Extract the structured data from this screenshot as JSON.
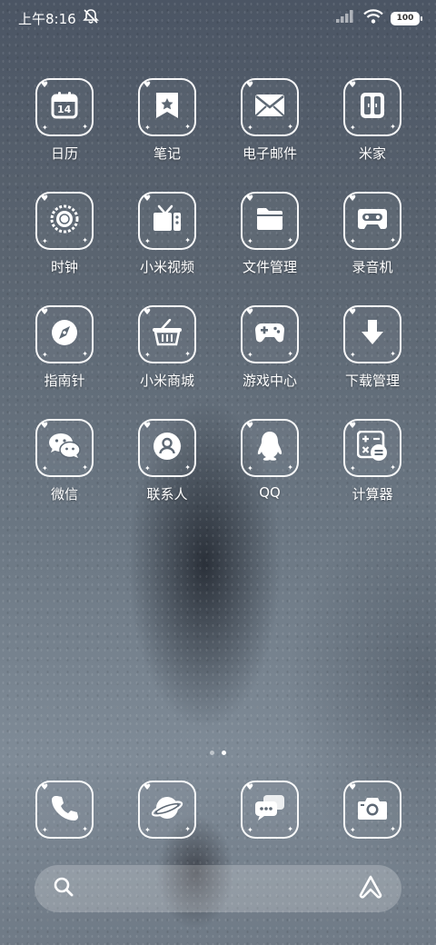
{
  "status_bar": {
    "time": "上午8:16",
    "icons": [
      "mute-icon",
      "signal-icon",
      "wifi-icon",
      "battery-icon"
    ],
    "battery": "100"
  },
  "apps": [
    {
      "label": "日历",
      "icon": "calendar-icon",
      "badge": "14"
    },
    {
      "label": "笔记",
      "icon": "notes-icon"
    },
    {
      "label": "电子邮件",
      "icon": "mail-icon"
    },
    {
      "label": "米家",
      "icon": "home-door-icon"
    },
    {
      "label": "时钟",
      "icon": "clock-icon"
    },
    {
      "label": "小米视频",
      "icon": "tv-icon"
    },
    {
      "label": "文件管理",
      "icon": "folder-icon"
    },
    {
      "label": "录音机",
      "icon": "cassette-icon"
    },
    {
      "label": "指南针",
      "icon": "compass-icon"
    },
    {
      "label": "小米商城",
      "icon": "shopping-basket-icon"
    },
    {
      "label": "游戏中心",
      "icon": "gamepad-icon"
    },
    {
      "label": "下载管理",
      "icon": "download-arrow-icon"
    },
    {
      "label": "微信",
      "icon": "wechat-icon"
    },
    {
      "label": "联系人",
      "icon": "contact-icon"
    },
    {
      "label": "QQ",
      "icon": "qq-penguin-icon"
    },
    {
      "label": "计算器",
      "icon": "calculator-icon"
    }
  ],
  "dock": [
    {
      "icon": "phone-icon"
    },
    {
      "icon": "browser-planet-icon"
    },
    {
      "icon": "messages-icon"
    },
    {
      "icon": "camera-icon"
    }
  ],
  "page_indicator": {
    "count": 2,
    "active": 2
  },
  "search": {
    "left_icon": "search-icon",
    "right_icon": "assistant-icon"
  },
  "colors": {
    "icon_outline": "#ffffff",
    "wallpaper": "#5d6874"
  }
}
